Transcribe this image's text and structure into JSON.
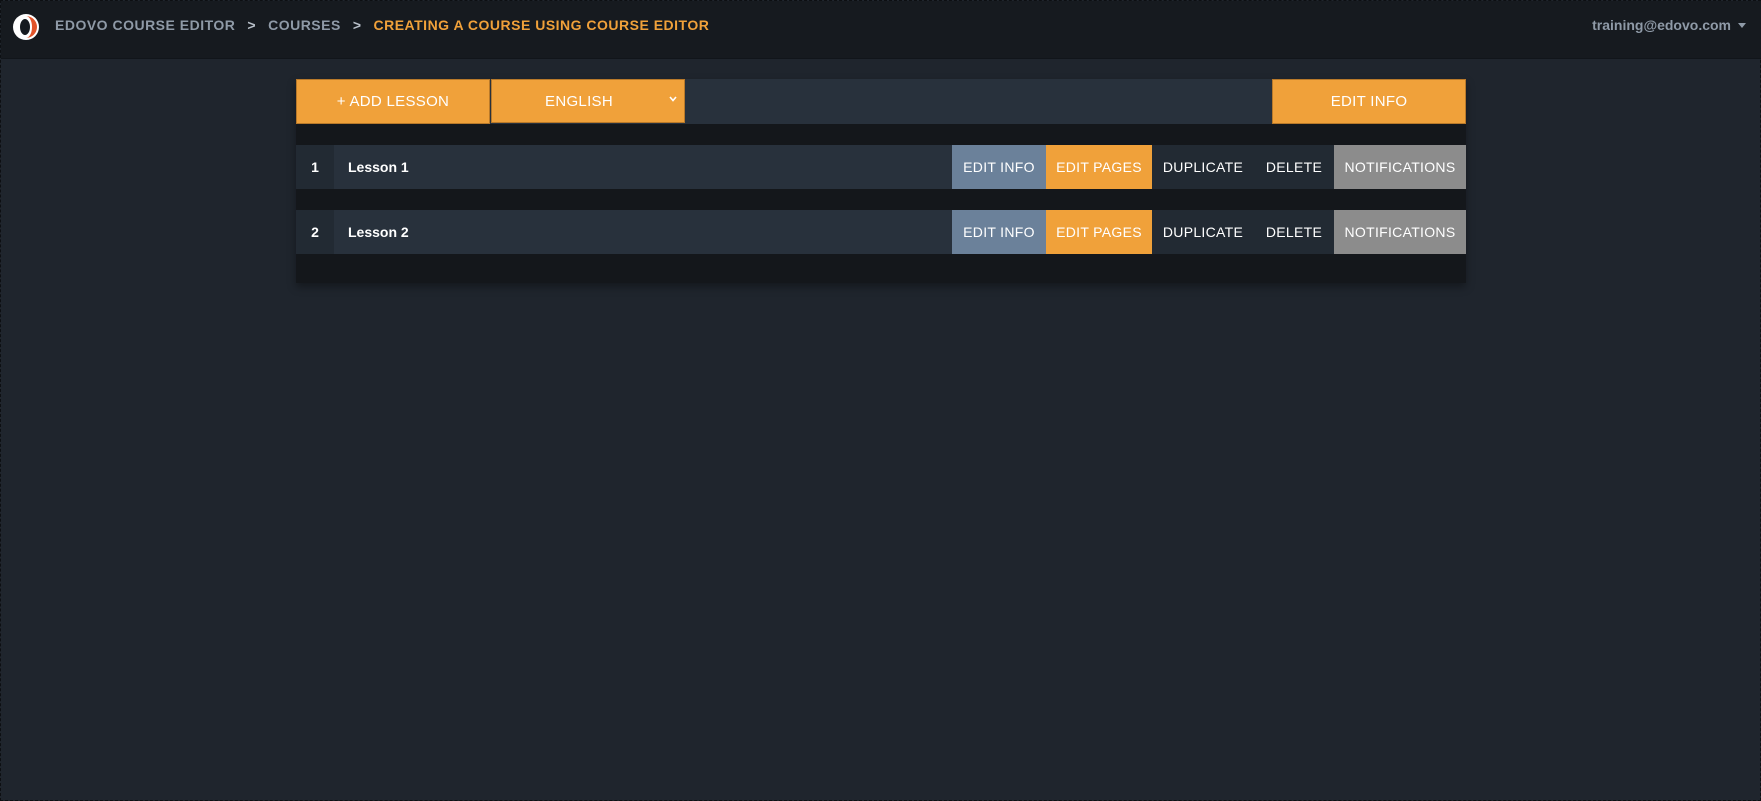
{
  "header": {
    "breadcrumb": [
      {
        "label": "EDOVO COURSE EDITOR"
      },
      {
        "label": "COURSES"
      },
      {
        "label": "CREATING A COURSE USING COURSE EDITOR"
      }
    ],
    "separator": ">",
    "user_email": "training@edovo.com"
  },
  "toolbar": {
    "add_lesson_label": "+ ADD LESSON",
    "language_selected": "ENGLISH",
    "edit_info_label": "EDIT INFO"
  },
  "lessons": [
    {
      "number": "1",
      "title": "Lesson 1"
    },
    {
      "number": "2",
      "title": "Lesson 2"
    }
  ],
  "row_actions": {
    "edit_info": "EDIT INFO",
    "edit_pages": "EDIT PAGES",
    "duplicate": "DUPLICATE",
    "delete": "DELETE",
    "notifications": "NOTIFICATIONS"
  },
  "colors": {
    "accent": "#f0a13a",
    "edit_info_bg": "#6b819a",
    "notifications_bg": "#8c8c8c",
    "background": "#1f252d"
  }
}
